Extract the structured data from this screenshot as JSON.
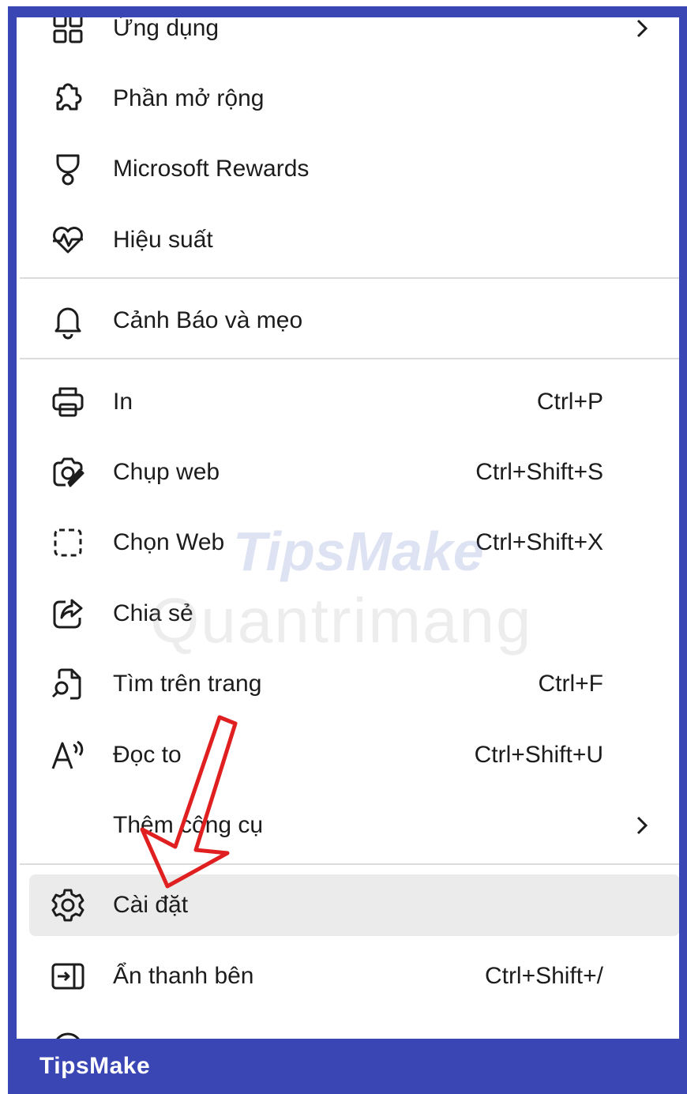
{
  "menu": {
    "items": [
      {
        "label": "Ứng dụng",
        "icon": "apps-icon",
        "chevron": true
      },
      {
        "label": "Phần mở rộng",
        "icon": "puzzle-icon"
      },
      {
        "label": "Microsoft Rewards",
        "icon": "trophy-icon"
      },
      {
        "label": "Hiệu suất",
        "icon": "heart-pulse-icon"
      },
      {
        "label": "Cảnh Báo và mẹo",
        "icon": "bell-icon"
      },
      {
        "label": "In",
        "icon": "printer-icon",
        "shortcut": "Ctrl+P"
      },
      {
        "label": "Chụp web",
        "icon": "web-capture-icon",
        "shortcut": "Ctrl+Shift+S"
      },
      {
        "label": "Chọn Web",
        "icon": "web-select-icon",
        "shortcut": "Ctrl+Shift+X"
      },
      {
        "label": "Chia sẻ",
        "icon": "share-icon"
      },
      {
        "label": "Tìm trên trang",
        "icon": "find-on-page-icon",
        "shortcut": "Ctrl+F"
      },
      {
        "label": "Đọc to",
        "icon": "read-aloud-icon",
        "shortcut": "Ctrl+Shift+U"
      },
      {
        "label": "Thêm công cụ",
        "chevron": true
      },
      {
        "label": "Cài đặt",
        "icon": "gear-icon",
        "highlighted": true
      },
      {
        "label": "Ẩn thanh bên",
        "icon": "hide-sidebar-icon",
        "shortcut": "Ctrl+Shift+/"
      }
    ]
  },
  "watermarks": {
    "brand": "TipsMake",
    "site": "Quantrimang"
  },
  "footer": {
    "brand": "TipsMake"
  },
  "colors": {
    "frame": "#3a46b4",
    "highlight": "#ebebeb",
    "arrow": "#e02020"
  }
}
